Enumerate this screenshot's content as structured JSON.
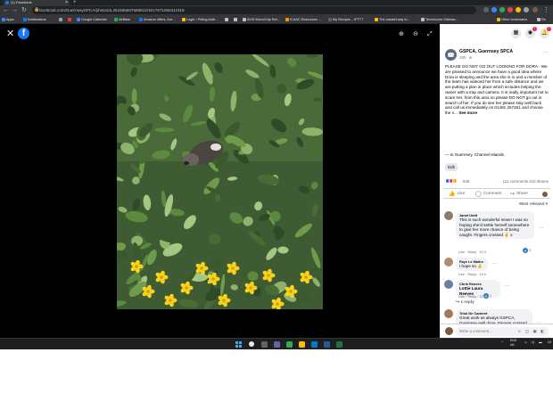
{
  "browser": {
    "tab_title": "(1) Facebook",
    "url": "facebook.com/GuernseySPCA/photos/a.261686667589812/4017671656311819",
    "bookmarks": [
      "Apps",
      "Notifications",
      "Google Calendar",
      "AirBase",
      "Amazon offers, Am...",
      "Login • Petlog Auth...",
      "AVID MicroChip Ret...",
      "ICAAC Resources -...",
      "My Recipes – IFTTT",
      "The easiest way to...",
      "Technicolor Gatewa...",
      "Other bookmarks",
      "Re"
    ]
  },
  "viewer": {
    "logo_letter": "f",
    "close_glyph": "✕",
    "zoom_in_glyph": "⊕",
    "zoom_out_glyph": "⊖",
    "fullscreen_glyph": "⤢"
  },
  "panel": {
    "notif_count": "2",
    "msg_count": "1",
    "post": {
      "page_name": "GSPCA, Guernsey SPCA",
      "time": "13h · ⊕",
      "body": "PLEASE DO NOT GO OUT LOOKING FOR DORA - We are pleased to announce we have a good idea where Dora is sleeping and the area she is in and a member of the team has videoed her from a safe distance and we are putting a plan in place which includes helping the owner with a trap and camera. It is really important not to scare her, from this area so please DO NOT go out in search of her. If you do see her please stay well back and call us immediately on 01481 257261 and choose the n...",
      "see_more": "See more",
      "location": "— in Guernsey, Channel Islands.",
      "edit_label": "Edit",
      "reaction_count": "645",
      "stats": "114 comments  310 shares"
    },
    "actions": {
      "like": "Like",
      "comment": "Comment",
      "share": "Share"
    },
    "sort_label": "Most relevant ▾",
    "comments": [
      {
        "name": "Janet Unitt",
        "text": "This is such wonderful news! I was so hoping she'd settle herself somewhere to give her more chance of being caught. Fingers crossed 🤞 x",
        "meta": "Like · Reply · 13 h",
        "likes": "3"
      },
      {
        "name": "Faye Le Maitre",
        "text": "I hope so 🤞",
        "meta": "Like · Reply · 13 h",
        "likes": ""
      },
      {
        "name": "Chris Reeves",
        "text": "Lottie Laura Reeves",
        "meta": "Like · Reply · 12 h",
        "likes": "1"
      },
      {
        "name": "Trish De Carteret",
        "text": "Great work as always GSPCA, Guernsey well done. Fingers crossed she is safely rescued.",
        "meta": "Like · Reply · 13 h",
        "likes": "1"
      }
    ],
    "reply_link": "↪ 1 reply",
    "write_placeholder": "Write a comment...",
    "write_icons": "☺ ◫ ▣ ◧"
  },
  "taskbar": {
    "tray_lang": "ENG",
    "tray_region": "UK",
    "clock_time": "15"
  },
  "colors": {
    "fb_blue": "#1877f2",
    "viewer_bg": "#000000",
    "panel_bg": "#ffffff",
    "bubble_bg": "#f0f2f5"
  }
}
